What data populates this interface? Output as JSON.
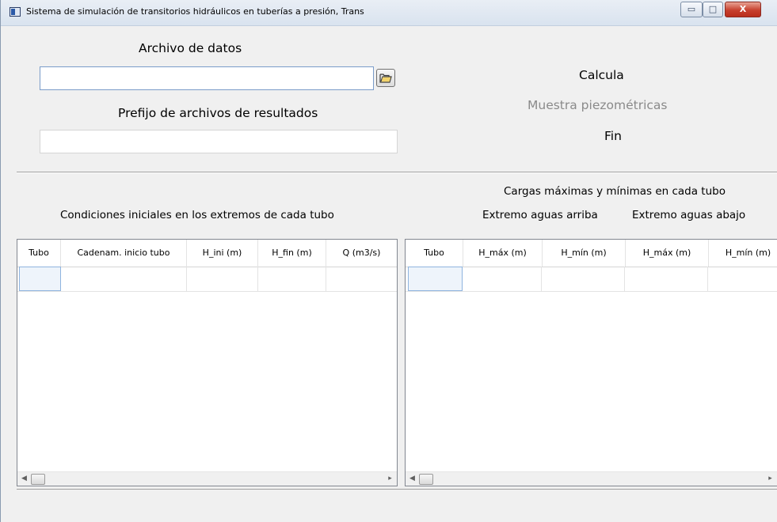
{
  "window": {
    "title": "Sistema de simulación de transitorios hidráulicos en tuberías a presión, Trans",
    "minimize_glyph": "▭",
    "maximize_glyph": "□",
    "close_glyph": "X"
  },
  "input_section": {
    "data_file_label": "Archivo de datos",
    "data_file_value": "",
    "browse_icon": "folder-open-icon",
    "results_prefix_label": "Prefijo de archivos de resultados",
    "results_prefix_value": ""
  },
  "actions": {
    "calculate": "Calcula",
    "show_piezometrics": "Muestra piezométricas",
    "end": "Fin"
  },
  "initial_conditions": {
    "title": "Condiciones iniciales en los extremos de cada tubo",
    "columns": [
      "Tubo",
      "Cadenam. inicio tubo",
      "H_ini (m)",
      "H_fin (m)",
      "Q (m3/s)"
    ],
    "rows": [
      [
        "",
        "",
        "",
        "",
        ""
      ]
    ]
  },
  "loads": {
    "title": "Cargas máximas y mínimas en cada tubo",
    "upstream_label": "Extremo aguas arriba",
    "downstream_label": "Extremo aguas abajo",
    "columns": [
      "Tubo",
      "H_máx (m)",
      "H_mín (m)",
      "H_máx (m)",
      "H_mín (m)"
    ],
    "rows": [
      [
        "",
        "",
        "",
        "",
        ""
      ]
    ]
  },
  "scroll": {
    "left_arrow": "◀",
    "right_arrow": "▸"
  },
  "colors": {
    "window_bg": "#f0f0f0",
    "disabled_text": "#8a8a8a",
    "close_button": "#c7402e"
  }
}
